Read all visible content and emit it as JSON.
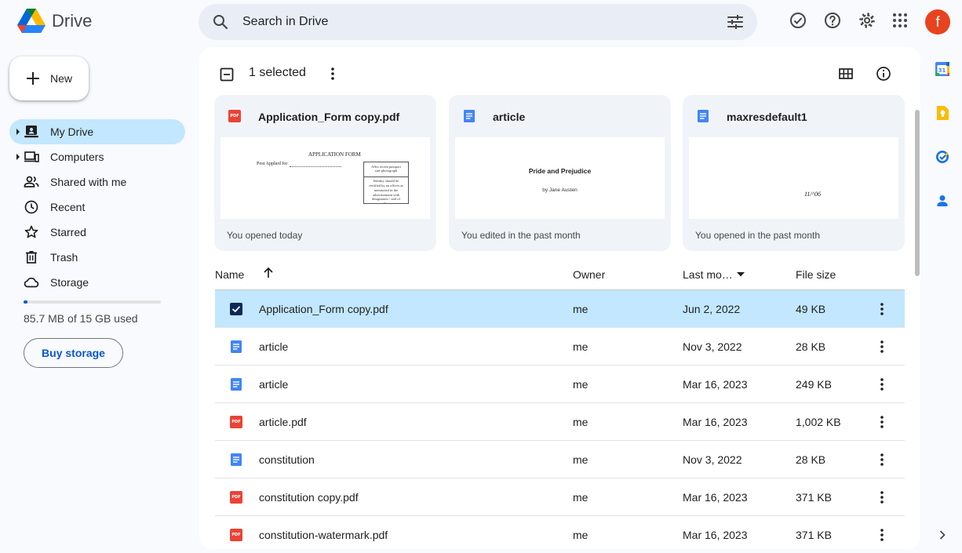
{
  "app": {
    "name": "Drive"
  },
  "search": {
    "placeholder": "Search in Drive"
  },
  "user": {
    "avatar_letter": "f"
  },
  "new_button": {
    "label": "New"
  },
  "nav": [
    {
      "label": "My Drive",
      "icon": "my-drive-icon",
      "active": true,
      "expandable": true
    },
    {
      "label": "Computers",
      "icon": "computers-icon",
      "active": false,
      "expandable": true
    },
    {
      "label": "Shared with me",
      "icon": "shared-icon",
      "active": false
    },
    {
      "label": "Recent",
      "icon": "clock-icon",
      "active": false
    },
    {
      "label": "Starred",
      "icon": "star-icon",
      "active": false
    },
    {
      "label": "Trash",
      "icon": "trash-icon",
      "active": false
    },
    {
      "label": "Storage",
      "icon": "cloud-icon",
      "active": false
    }
  ],
  "storage": {
    "used_text": "85.7 MB of 15 GB used",
    "used_fraction": 0.006,
    "buy_label": "Buy storage"
  },
  "selection": {
    "text": "1 selected"
  },
  "suggested": [
    {
      "title": "Application_Form copy.pdf",
      "type": "pdf",
      "footer": "You opened today",
      "preview": {
        "heading": "APPLICATION FORM",
        "field": "Post Applied for",
        "box": "Affix recent passport size photograph",
        "note": "Identity should be certified by an officer as mentioned in the advertisement with designation / seal of office."
      }
    },
    {
      "title": "article",
      "type": "doc",
      "footer": "You edited in the past month",
      "preview": {
        "heading": "Pride and Prejudice",
        "sub": "by Jane Austen"
      }
    },
    {
      "title": "maxresdefault1",
      "type": "doc",
      "footer": "You opened in the past month",
      "preview": {
        "text": "11/^06"
      }
    }
  ],
  "table": {
    "headers": {
      "name": "Name",
      "owner": "Owner",
      "modified": "Last mo…",
      "size": "File size"
    },
    "rows": [
      {
        "name": "Application_Form copy.pdf",
        "type": "pdf",
        "owner": "me",
        "modified": "Jun 2, 2022",
        "size": "49 KB",
        "selected": true
      },
      {
        "name": "article",
        "type": "doc",
        "owner": "me",
        "modified": "Nov 3, 2022",
        "size": "28 KB"
      },
      {
        "name": "article",
        "type": "doc",
        "owner": "me",
        "modified": "Mar 16, 2023",
        "size": "249 KB"
      },
      {
        "name": "article.pdf",
        "type": "pdf",
        "owner": "me",
        "modified": "Mar 16, 2023",
        "size": "1,002 KB"
      },
      {
        "name": "constitution",
        "type": "doc",
        "owner": "me",
        "modified": "Nov 3, 2022",
        "size": "28 KB"
      },
      {
        "name": "constitution copy.pdf",
        "type": "pdf",
        "owner": "me",
        "modified": "Mar 16, 2023",
        "size": "371 KB"
      },
      {
        "name": "constitution-watermark.pdf",
        "type": "pdf",
        "owner": "me",
        "modified": "Mar 16, 2023",
        "size": "371 KB"
      }
    ]
  },
  "side_panel": {
    "calendar_day": "31"
  },
  "colors": {
    "accent": "#0b57d0",
    "selected": "#c2e7ff",
    "pdf": "#ea4335",
    "doc": "#4285f4"
  }
}
